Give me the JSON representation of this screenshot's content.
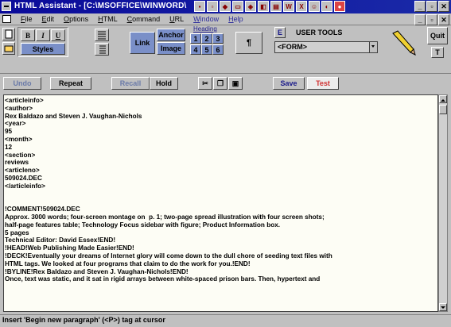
{
  "window": {
    "title": "HTML Assistant - [C:\\MSOFFICE\\WINWORD\\",
    "min_label": "_",
    "max_label": "▫",
    "close_label": "✕"
  },
  "menu": {
    "items": [
      "File",
      "Edit",
      "Options",
      "HTML",
      "Command",
      "URL",
      "Window",
      "Help"
    ],
    "ctrl_min": "_",
    "ctrl_max": "▫",
    "ctrl_close": "✕"
  },
  "toolbar": {
    "bold": "B",
    "italic": "I",
    "underline": "U",
    "styles": "Styles",
    "link": "Link",
    "anchor": "Anchor",
    "image": "Image",
    "heading_label": "Heading",
    "headings": [
      "1",
      "2",
      "3",
      "4",
      "5",
      "6"
    ],
    "para": "¶",
    "user_tools_icon": "E",
    "user_tools": "USER TOOLS",
    "tag_select": "<FORM>",
    "quit": "Quit",
    "t_button": "T"
  },
  "actions": {
    "undo": "Undo",
    "repeat": "Repeat",
    "recall": "Recall",
    "hold": "Hold",
    "save": "Save",
    "test": "Test"
  },
  "editor": {
    "lines": [
      "<articleinfo>",
      "<author>",
      "Rex Baldazo and Steven J. Vaughan-Nichols",
      "<year>",
      "95",
      "<month>",
      "12",
      "<section>",
      "reviews",
      "<articleno>",
      "509024.DEC",
      "</articleinfo>",
      "",
      "",
      "!COMMENT!509024.DEC",
      "Approx. 3000 words; four-screen montage on  p. 1; two-page spread illustration with four screen shots;",
      "half-page features table; Technology Focus sidebar with figure; Product Information box.",
      "5 pages",
      "Technical Editor: David Essex!END!",
      "!HEAD!Web Publishing Made Easier!END!",
      "!DECK!Eventually your dreams of Internet glory will come down to the dull chore of seeding text files with",
      "HTML tags. We looked at four programs that claim to do the work for you.!END!",
      "!BYLINE!Rex Baldazo and Steven J. Vaughan-Nichols!END!",
      "Once, text was static, and it sat in rigid arrays between white-spaced prison bars. Then, hypertext and"
    ]
  },
  "status": {
    "text": "Insert 'Begin new paragraph' (<P>) tag at cursor"
  }
}
